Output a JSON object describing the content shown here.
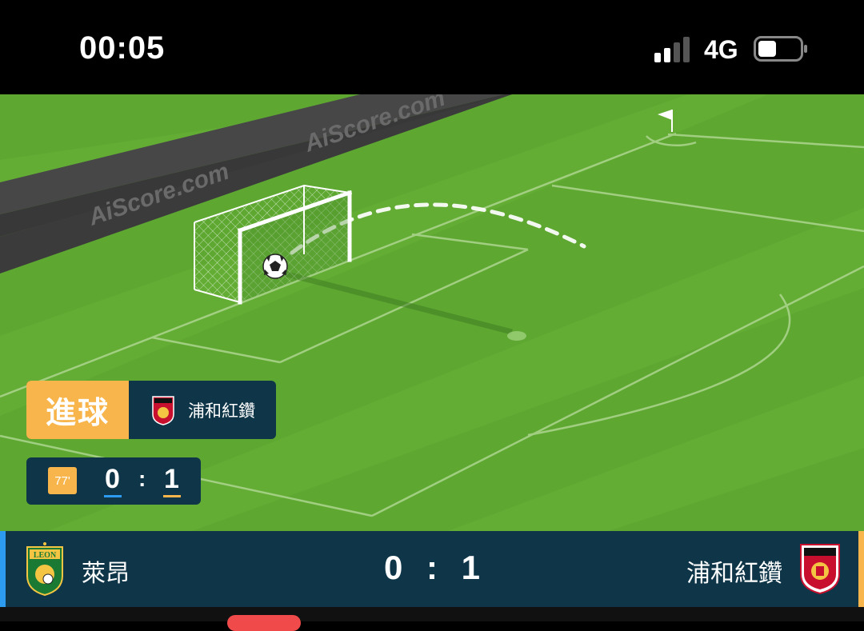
{
  "status_bar": {
    "time": "00:05",
    "network": "4G"
  },
  "pitch": {
    "watermark": "AiScore.com"
  },
  "goal_event": {
    "label": "進球",
    "team": "浦和紅鑽"
  },
  "mini_score": {
    "minute": "77'",
    "home": "0",
    "separator": ":",
    "away": "1"
  },
  "scoreboard": {
    "home_team": "萊昂",
    "away_team": "浦和紅鑽",
    "home_score": "0",
    "separator": ":",
    "away_score": "1"
  },
  "colors": {
    "pitch": "#5ea832",
    "panel": "#0e3548",
    "goal_accent": "#f8b54b",
    "home_accent": "#2d9cf0",
    "away_accent": "#f8b54b"
  },
  "icons": [
    "signal-icon",
    "battery-icon",
    "soccer-ball-icon",
    "corner-flag-icon",
    "leon-crest-icon",
    "urawa-crest-icon"
  ]
}
